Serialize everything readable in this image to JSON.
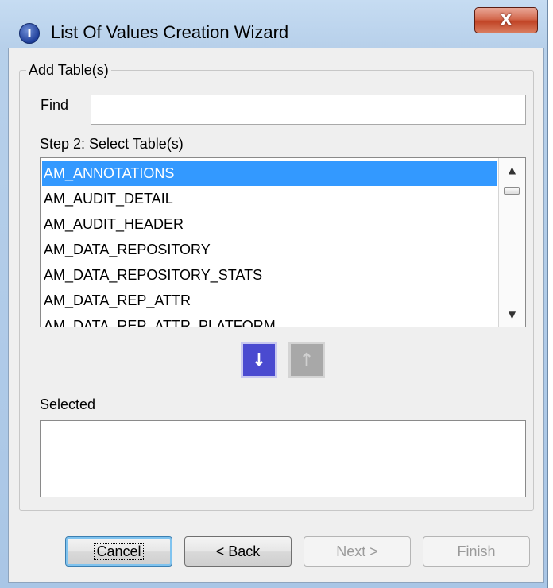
{
  "window": {
    "title": "List Of Values Creation Wizard",
    "icon": "info-icon",
    "icon_glyph": "I",
    "close_glyph": "X"
  },
  "group": {
    "legend": "Add Table(s)"
  },
  "find": {
    "label": "Find",
    "value": ""
  },
  "step": {
    "label": "Step 2: Select Table(s)"
  },
  "tables": {
    "items": [
      "AM_ANNOTATIONS",
      "AM_AUDIT_DETAIL",
      "AM_AUDIT_HEADER",
      "AM_DATA_REPOSITORY",
      "AM_DATA_REPOSITORY_STATS",
      "AM_DATA_REP_ATTR",
      "AM_DATA_REP_ATTR_PLATFORM"
    ],
    "selected_index": 0
  },
  "move": {
    "down_glyph": "↓",
    "up_glyph": "↑"
  },
  "selected": {
    "label": "Selected"
  },
  "buttons": {
    "cancel": "Cancel",
    "back": "< Back",
    "next": "Next >",
    "finish": "Finish"
  },
  "colors": {
    "selection": "#3399ff",
    "move_down_active": "#4a4ad0",
    "move_up_disabled": "#a8a8a8"
  }
}
